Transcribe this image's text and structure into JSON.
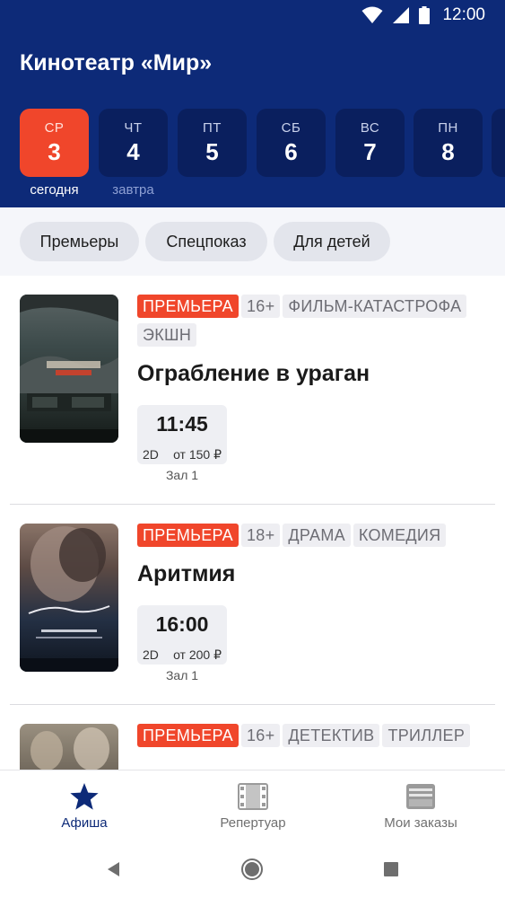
{
  "status_bar": {
    "time": "12:00"
  },
  "header": {
    "title": "Кинотеатр «Мир»"
  },
  "dates": [
    {
      "dow": "СР",
      "num": "3",
      "caption": "сегодня",
      "active": true
    },
    {
      "dow": "ЧТ",
      "num": "4",
      "caption": "завтра",
      "active": false
    },
    {
      "dow": "ПТ",
      "num": "5",
      "caption": "",
      "active": false
    },
    {
      "dow": "СБ",
      "num": "6",
      "caption": "",
      "active": false
    },
    {
      "dow": "ВС",
      "num": "7",
      "caption": "",
      "active": false
    },
    {
      "dow": "ПН",
      "num": "8",
      "caption": "",
      "active": false
    }
  ],
  "filters": [
    "Премьеры",
    "Спецпоказ",
    "Для детей"
  ],
  "movies": [
    {
      "title": "Ограбление в ураган",
      "tags": [
        "ПРЕМЬЕРА",
        "16+",
        "ФИЛЬМ-КАТАСТРОФА",
        "ЭКШН"
      ],
      "session": {
        "time": "11:45",
        "format": "2D",
        "price": "от 150 ₽",
        "hall": "Зал 1"
      },
      "poster_colors": [
        "#3c4a4a",
        "#1c2222"
      ]
    },
    {
      "title": "Аритмия",
      "tags": [
        "ПРЕМЬЕРА",
        "18+",
        "ДРАМА",
        "КОМЕДИЯ"
      ],
      "session": {
        "time": "16:00",
        "format": "2D",
        "price": "от 200 ₽",
        "hall": "Зал 1"
      },
      "poster_colors": [
        "#6b5a52",
        "#141a24"
      ]
    },
    {
      "title": "",
      "tags": [
        "ПРЕМЬЕРА",
        "16+",
        "ДЕТЕКТИВ",
        "ТРИЛЛЕР"
      ],
      "poster_colors": [
        "#8a8070",
        "#2a2622"
      ]
    }
  ],
  "bottom_nav": [
    {
      "label": "Афиша",
      "icon": "star-icon",
      "active": true
    },
    {
      "label": "Репертуар",
      "icon": "film-icon",
      "active": false
    },
    {
      "label": "Мои заказы",
      "icon": "wallet-icon",
      "active": false
    }
  ],
  "colors": {
    "header": "#0d2a78",
    "accent": "#f0462b",
    "date_tile": "#0a1f5e"
  }
}
